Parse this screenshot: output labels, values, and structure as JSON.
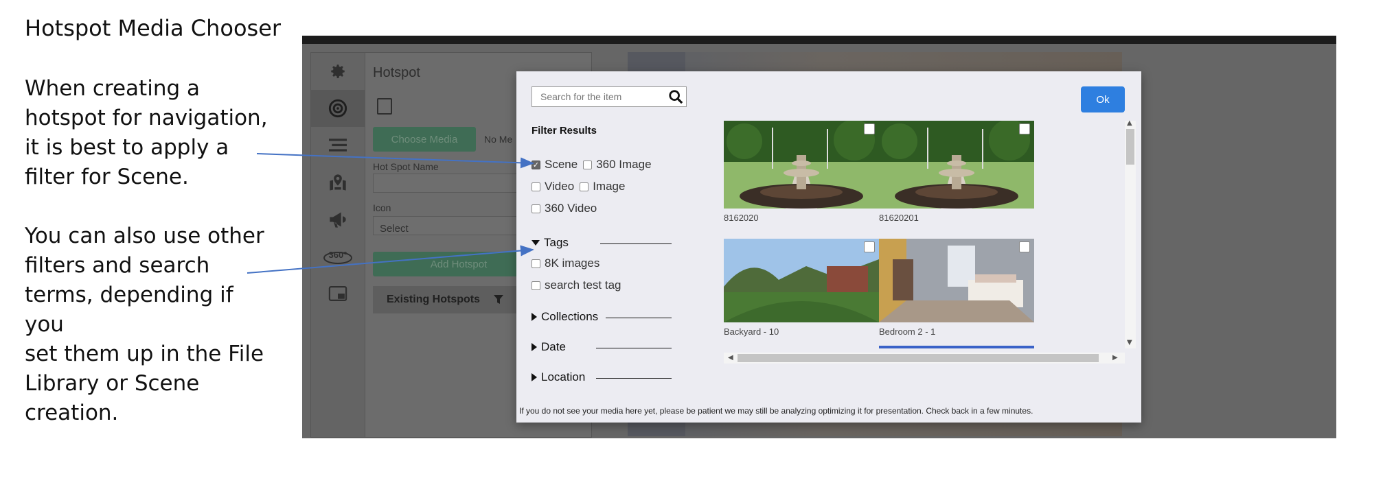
{
  "annotation": {
    "title": "Hotspot Media Chooser",
    "note1": "When creating a\nhotspot for navigation,\nit is best to apply a\nfilter for Scene.",
    "note2": "You can also use other\nfilters and search\nterms, depending if you\nset them up in the File\nLibrary or Scene\ncreation."
  },
  "background_app": {
    "panel_title": "Hotspot",
    "choose_media_label": "Choose Media",
    "no_media_label": "No Me",
    "hotspot_name_label": "Hot Spot Name",
    "icon_label": "Icon",
    "icon_select_value": "Select",
    "add_hotspot_label": "Add Hotspot",
    "existing_hotspots_label": "Existing Hotspots",
    "sidebar_icons": [
      "gear-icon",
      "target-icon",
      "list-icon",
      "map-icon",
      "megaphone-icon",
      "360-icon",
      "picture-in-picture-icon"
    ]
  },
  "modal": {
    "search_placeholder": "Search for the item",
    "ok_label": "Ok",
    "filter_title": "Filter Results",
    "filters": {
      "scene": {
        "label": "Scene",
        "checked": true
      },
      "image360": {
        "label": "360 Image",
        "checked": false
      },
      "video": {
        "label": "Video",
        "checked": false
      },
      "image": {
        "label": "Image",
        "checked": false
      },
      "video360": {
        "label": "360 Video",
        "checked": false
      }
    },
    "tags_label": "Tags",
    "tags": [
      "8K images",
      "search test tag"
    ],
    "collections_label": "Collections",
    "date_label": "Date",
    "location_label": "Location",
    "media": [
      {
        "label": "8162020",
        "kind": "fountain"
      },
      {
        "label": "81620201",
        "kind": "fountain"
      },
      {
        "label": "Backyard - 10",
        "kind": "backyard"
      },
      {
        "label": "Bedroom 2 - 1",
        "kind": "bedroom"
      }
    ],
    "footer_note": "If you do not see your media here yet, please be patient we may still be analyzing optimizing it for presentation. Check back in a few minutes."
  },
  "colors": {
    "ok_button": "#2e7fe0",
    "arrow": "#4472c4",
    "modal_bg": "#ececf2"
  }
}
